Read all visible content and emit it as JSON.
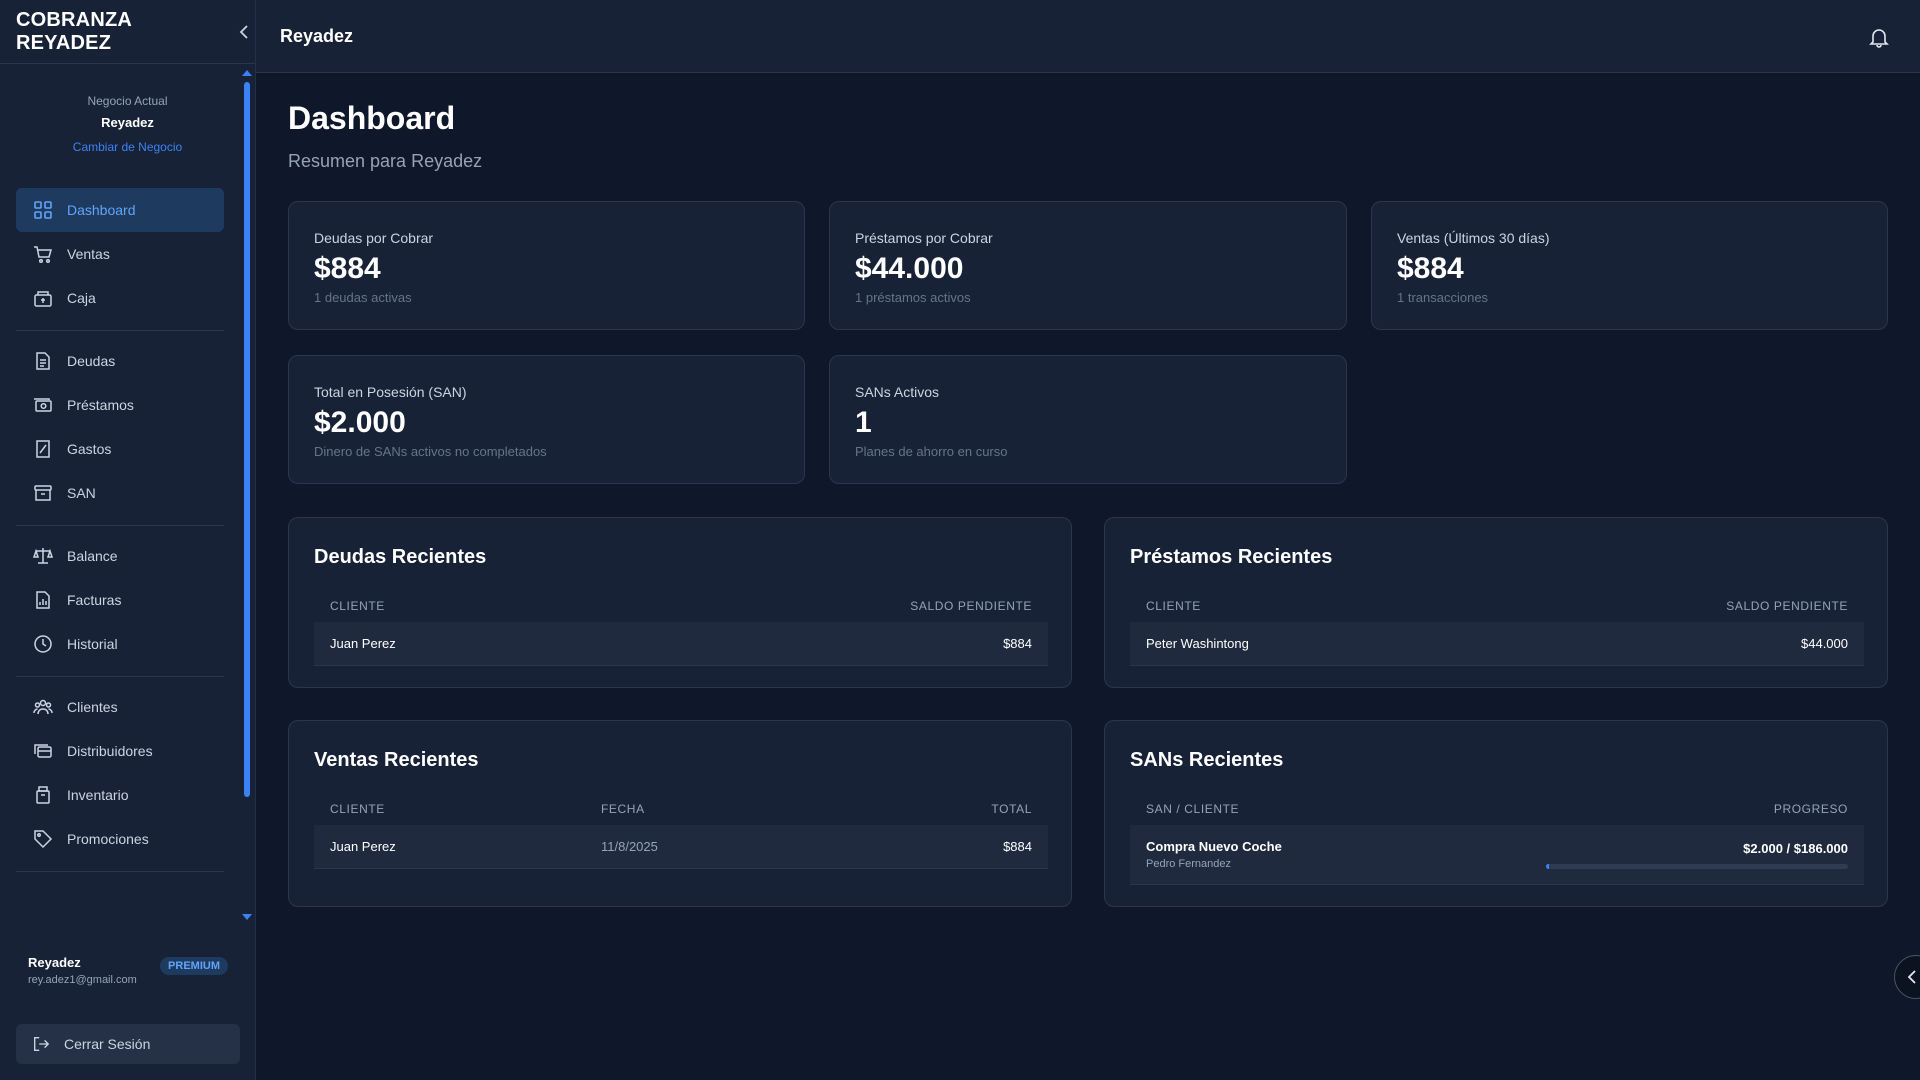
{
  "brand": {
    "title": "COBRANZA REYADEZ",
    "collapse_icon": "chevron-left-icon"
  },
  "business": {
    "label": "Negocio Actual",
    "name": "Reyadez",
    "change_link": "Cambiar de Negocio"
  },
  "sidebar": {
    "group1": [
      {
        "label": "Dashboard",
        "icon": "grid-icon",
        "active": true
      },
      {
        "label": "Ventas",
        "icon": "cart-icon"
      },
      {
        "label": "Caja",
        "icon": "cash-register-icon"
      }
    ],
    "group2": [
      {
        "label": "Deudas",
        "icon": "document-icon"
      },
      {
        "label": "Préstamos",
        "icon": "money-icon"
      },
      {
        "label": "Gastos",
        "icon": "receipt-icon"
      },
      {
        "label": "SAN",
        "icon": "archive-icon"
      }
    ],
    "group3": [
      {
        "label": "Balance",
        "icon": "scale-icon"
      },
      {
        "label": "Facturas",
        "icon": "chart-document-icon"
      },
      {
        "label": "Historial",
        "icon": "clock-icon"
      }
    ],
    "group4": [
      {
        "label": "Clientes",
        "icon": "users-icon"
      },
      {
        "label": "Distribuidores",
        "icon": "cards-icon"
      },
      {
        "label": "Inventario",
        "icon": "box-icon"
      },
      {
        "label": "Promociones",
        "icon": "tag-icon"
      }
    ]
  },
  "user": {
    "name": "Reyadez",
    "email": "rey.adez1@gmail.com",
    "badge": "PREMIUM"
  },
  "logout_label": "Cerrar Sesión",
  "topbar": {
    "title": "Reyadez"
  },
  "page": {
    "title": "Dashboard",
    "subtitle": "Resumen para Reyadez"
  },
  "stats": [
    {
      "label": "Deudas por Cobrar",
      "value": "$884",
      "sub": "1 deudas activas"
    },
    {
      "label": "Préstamos por Cobrar",
      "value": "$44.000",
      "sub": "1 préstamos activos"
    },
    {
      "label": "Ventas (Últimos 30 días)",
      "value": "$884",
      "sub": "1 transacciones"
    },
    {
      "label": "Total en Posesión (SAN)",
      "value": "$2.000",
      "sub": "Dinero de SANs activos no completados"
    },
    {
      "label": "SANs Activos",
      "value": "1",
      "sub": "Planes de ahorro en curso"
    }
  ],
  "deudas_recientes": {
    "title": "Deudas Recientes",
    "headers": [
      "CLIENTE",
      "SALDO PENDIENTE"
    ],
    "rows": [
      {
        "cliente": "Juan Perez",
        "saldo": "$884"
      }
    ]
  },
  "prestamos_recientes": {
    "title": "Préstamos Recientes",
    "headers": [
      "CLIENTE",
      "SALDO PENDIENTE"
    ],
    "rows": [
      {
        "cliente": "Peter Washintong",
        "saldo": "$44.000"
      }
    ]
  },
  "ventas_recientes": {
    "title": "Ventas Recientes",
    "headers": [
      "CLIENTE",
      "FECHA",
      "TOTAL"
    ],
    "rows": [
      {
        "cliente": "Juan Perez",
        "fecha": "11/8/2025",
        "total": "$884"
      }
    ]
  },
  "sans_recientes": {
    "title": "SANs Recientes",
    "headers": [
      "SAN / CLIENTE",
      "PROGRESO"
    ],
    "rows": [
      {
        "san": "Compra Nuevo Coche",
        "cliente": "Pedro Fernandez",
        "progreso": "$2.000 / $186.000",
        "progress_fraction": 0.0108
      }
    ]
  },
  "colors": {
    "accent": "#3b82f6",
    "background": "#0f172a",
    "panel": "#182237"
  }
}
